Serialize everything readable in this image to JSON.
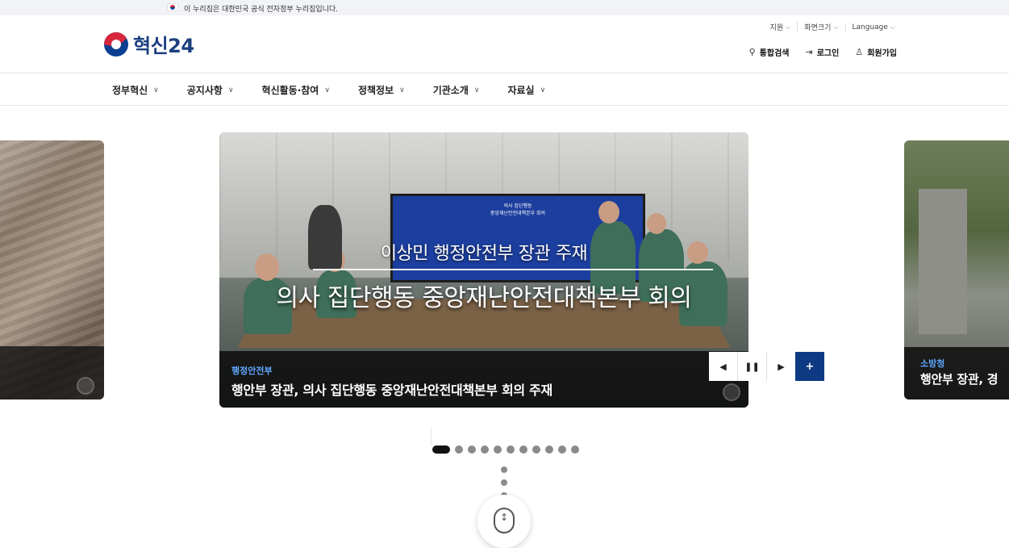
{
  "gov_banner": {
    "text": "이 누리집은 대한민국 공식 전자정부 누리집입니다."
  },
  "logo": {
    "text": "혁신24"
  },
  "util_links": [
    {
      "label": "지원"
    },
    {
      "label": "화면크기"
    },
    {
      "label": "Language"
    }
  ],
  "actions": {
    "search": "통합검색",
    "login": "로그인",
    "signup": "회원가입"
  },
  "nav": [
    {
      "label": "정부혁신"
    },
    {
      "label": "공지사항"
    },
    {
      "label": "혁신활동·참여"
    },
    {
      "label": "정책정보"
    },
    {
      "label": "기관소개"
    },
    {
      "label": "자료실"
    }
  ],
  "carousel": {
    "main": {
      "screen_title_1": "의사 집단행동",
      "screen_title_2": "중앙재난안전대책본부 회의",
      "overlay_sub": "이상민 행정안전부 장관 주재",
      "overlay_main": "의사 집단행동 중앙재난안전대책본부 회의",
      "agency": "행정안전부",
      "title": "행안부 장관, 의사 집단행동 중앙재난안전대책본부 회의 주재"
    },
    "right": {
      "agency": "소방청",
      "title": "행안부 장관, 경"
    },
    "controls": {
      "prev": "◀",
      "pause": "❚❚",
      "next": "▶",
      "plus": "+"
    },
    "page_count": 11,
    "active_page": 1
  },
  "colors": {
    "brand_blue": "#0d3a82",
    "agency_blue": "#5fa8ff"
  }
}
